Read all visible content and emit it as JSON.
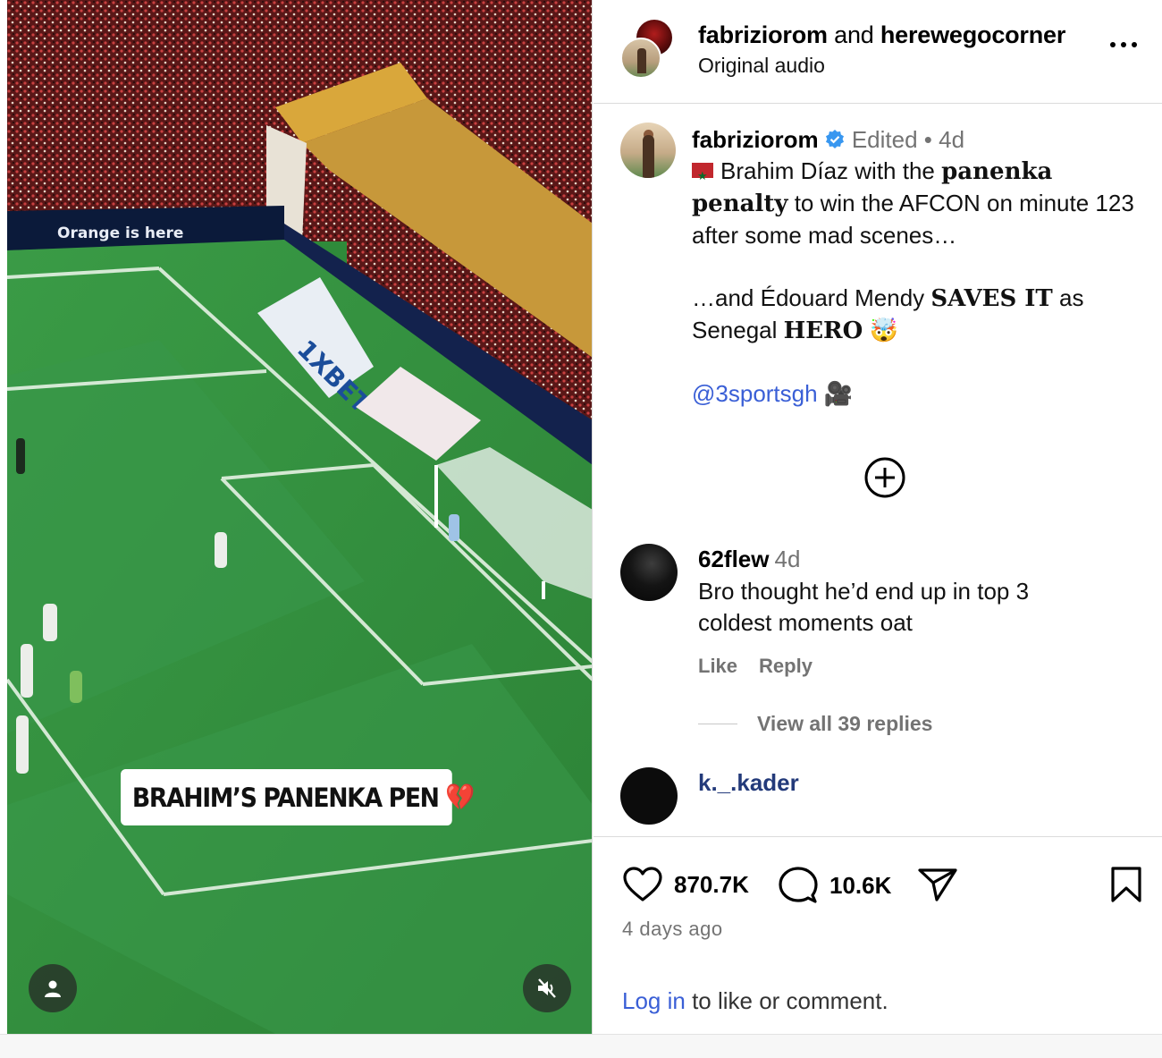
{
  "video": {
    "caption_text": "BRAHIM’S PANENKA PEN",
    "caption_emoji": "💔",
    "banner_text": "Orange is here",
    "board_text": "1XBET",
    "user_button_icon": "person-icon",
    "mute_button_icon": "speaker-muted-icon"
  },
  "header": {
    "user1": "fabriziorom",
    "joiner": "and",
    "user2": "herewegocorner",
    "audio": "Original audio",
    "more_icon": "more-horizontal-icon"
  },
  "caption": {
    "username": "fabriziorom",
    "edited": "Edited",
    "dot": "•",
    "time": "4d",
    "line1_pre": "Brahim Díaz with the ",
    "line1_bold": "panenka",
    "line2_bold": "penalty",
    "line2_post": " to win the AFCON on minute 123",
    "line3": "after some mad scenes…",
    "line4_pre": "…and Édouard Mendy ",
    "line4_bold": "SAVES IT",
    "line4_post": " as",
    "line5_pre": "Senegal ",
    "line5_bold": "HERO",
    "line5_emoji": "🤯",
    "mention": "@3sportsgh",
    "mention_emoji": "🎥",
    "flag": "Morocco"
  },
  "comments": [
    {
      "username": "62flew",
      "time": "4d",
      "line1": "Bro thought he’d end up in top 3",
      "line2": "coldest moments oat",
      "like_label": "Like",
      "reply_label": "Reply",
      "view_replies": "View all 39 replies"
    },
    {
      "username": "k._.kader"
    }
  ],
  "actions": {
    "likes": "870.7K",
    "comments": "10.6K",
    "posted": "4 days ago",
    "login_link": "Log in",
    "login_rest": " to like or comment."
  },
  "colors": {
    "link": "#3a5fd6",
    "muted": "#737373",
    "pitch": "#2f8a3a",
    "divider": "#dbdbdb"
  }
}
